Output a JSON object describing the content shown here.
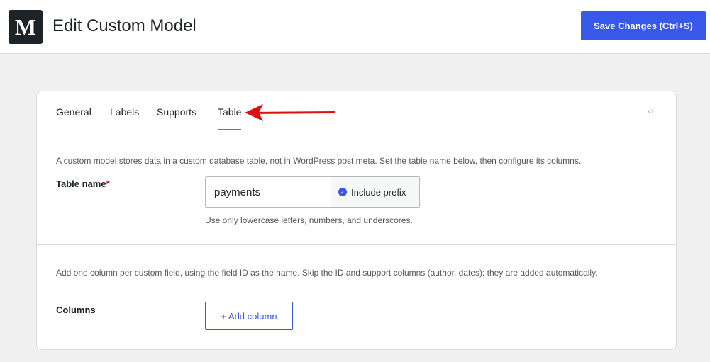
{
  "header": {
    "logo_letter": "M",
    "title": "Edit Custom Model",
    "save_label": "Save Changes (Ctrl+S)"
  },
  "tabs": [
    {
      "label": "General",
      "active": false
    },
    {
      "label": "Labels",
      "active": false
    },
    {
      "label": "Supports",
      "active": false
    },
    {
      "label": "Table",
      "active": true
    }
  ],
  "code_toggle_icon": "‹›",
  "table_section": {
    "description": "A custom model stores data in a custom database table, not in WordPress post meta. Set the table name below, then configure its columns.",
    "label": "Table name",
    "required_mark": "*",
    "value": "payments",
    "prefix_label": "Include prefix",
    "prefix_checked": true,
    "hint": "Use only lowercase letters, numbers, and underscores."
  },
  "columns_section": {
    "description": "Add one column per custom field, using the field ID as the name. Skip the ID and support columns (author, dates); they are added automatically.",
    "label": "Columns",
    "add_label": "+ Add column"
  },
  "colors": {
    "accent": "#3858e9",
    "annotation_arrow": "#dd1111"
  },
  "icons": {
    "check": "check-circle-icon",
    "code": "code-toggle-icon",
    "annotation": "red-arrow-icon"
  }
}
